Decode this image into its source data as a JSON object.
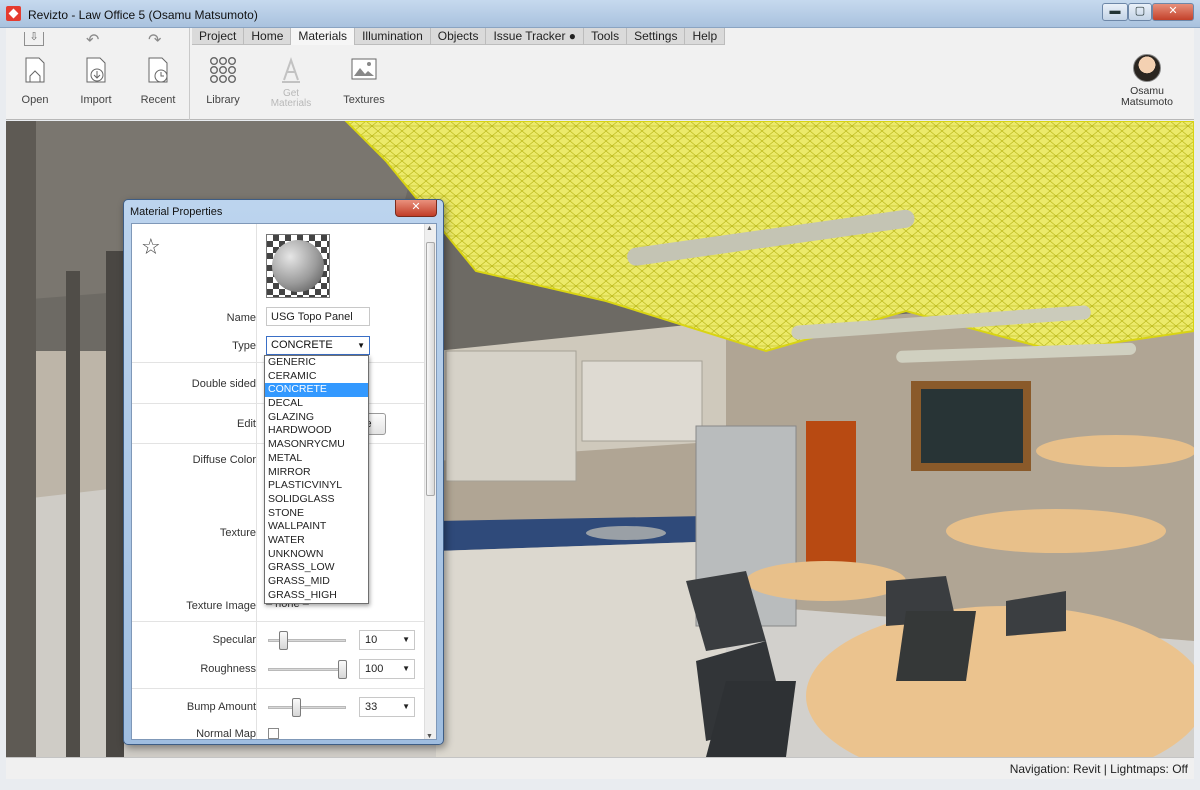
{
  "window": {
    "title": "Revizto  - Law Office 5 (Osamu Matsumoto)",
    "min_glyph": "▬",
    "max_glyph": "▢",
    "close_glyph": "✕"
  },
  "quick_tools": [
    {
      "label": "Open",
      "icon": "house-open-icon"
    },
    {
      "label": "Import",
      "icon": "document-import-icon"
    },
    {
      "label": "Recent",
      "icon": "document-recent-icon"
    }
  ],
  "quick_access": {
    "save_glyph": "⇩",
    "undo_glyph": "↶",
    "redo_glyph": "↷"
  },
  "tabs": [
    "Project",
    "Home",
    "Materials",
    "Illumination",
    "Objects",
    "Issue Tracker ●",
    "Tools",
    "Settings",
    "Help"
  ],
  "active_tab": "Materials",
  "materials_tools": [
    {
      "label": "Library",
      "icon": "library-grid-icon",
      "enabled": true
    },
    {
      "label": "Get Materials",
      "icon": "get-materials-icon",
      "enabled": false
    },
    {
      "label": "Textures",
      "icon": "texture-image-icon",
      "enabled": true
    }
  ],
  "user": {
    "name": "Osamu Matsumoto"
  },
  "status": {
    "text": "Navigation: Revit  |  Lightmaps: Off"
  },
  "dialog": {
    "title": "Material Properties",
    "close_glyph": "✕",
    "star_glyph": "☆",
    "labels": {
      "name": "Name",
      "type": "Type",
      "double_sided": "Double sided",
      "edit": "Edit",
      "diffuse_color": "Diffuse Color",
      "texture": "Texture",
      "texture_image": "Texture Image",
      "specular": "Specular",
      "roughness": "Roughness",
      "bump_amount": "Bump Amount",
      "normal_map": "Normal Map"
    },
    "name_value": "USG Topo Panel",
    "type_value": "CONCRETE",
    "select_arrow": "▼",
    "edit_button_partial": "ce",
    "texture_image_value": "– none –",
    "specular": {
      "value": "10",
      "fraction": 0.15
    },
    "roughness": {
      "value": "100",
      "fraction": 1.0
    },
    "bump_amount": {
      "value": "33",
      "fraction": 0.33
    },
    "normal_map_checked": false,
    "scroll_up": "▲",
    "scroll_down": "▼"
  },
  "type_options": [
    "GENERIC",
    "CERAMIC",
    "CONCRETE",
    "DECAL",
    "GLAZING",
    "HARDWOOD",
    "MASONRYCMU",
    "METAL",
    "MIRROR",
    "PLASTICVINYL",
    "SOLIDGLASS",
    "STONE",
    "WALLPAINT",
    "WATER",
    "UNKNOWN",
    "GRASS_LOW",
    "GRASS_MID",
    "GRASS_HIGH"
  ],
  "colors": {
    "selection": "#3399ff",
    "mesh_yellow": "#e8e41a",
    "counter_blue": "#2f4a7a",
    "table_wood": "#e8c08a"
  }
}
